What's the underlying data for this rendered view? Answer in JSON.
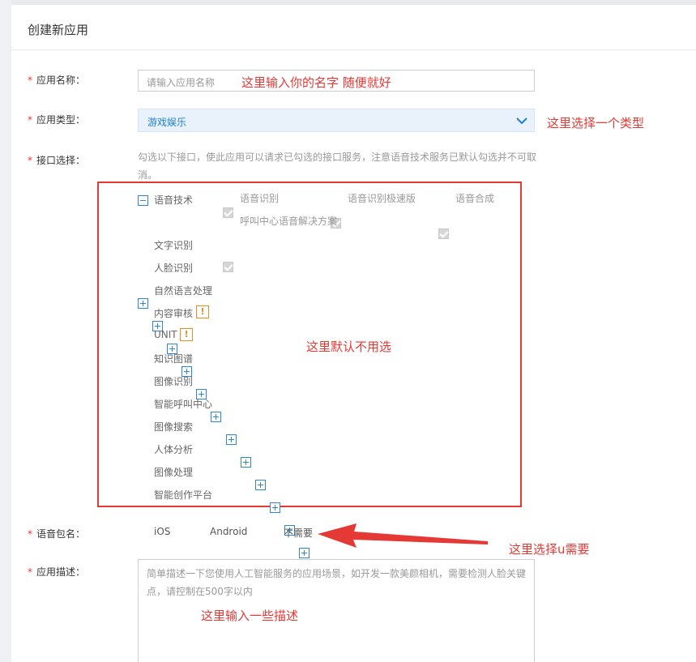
{
  "page": {
    "title": "创建新应用"
  },
  "form": {
    "app_name": {
      "label": "应用名称：",
      "placeholder": "请输入应用名称",
      "annotation": "这里输入你的名字  随便就好"
    },
    "app_type": {
      "label": "应用类型：",
      "value": "游戏娱乐",
      "annotation": "这里选择一个类型"
    },
    "api_select": {
      "label": "接口选择：",
      "hint": "勾选以下接口，使此应用可以请求已勾选的接口服务，注意语音技术服务已默认勾选并不可取消。",
      "annotation": "这里默认不用选",
      "speech": {
        "label": "语音技术",
        "options": [
          "语音识别",
          "语音识别极速版",
          "语音合成",
          "呼叫中心语音解决方案"
        ]
      },
      "categories": [
        {
          "label": "文字识别"
        },
        {
          "label": "人脸识别"
        },
        {
          "label": "自然语言处理"
        },
        {
          "label": "内容审核",
          "warn": "!"
        },
        {
          "label": "UNIT",
          "warn": "!"
        },
        {
          "label": "知识图谱"
        },
        {
          "label": "图像识别"
        },
        {
          "label": "智能呼叫中心"
        },
        {
          "label": "图像搜索"
        },
        {
          "label": "人体分析"
        },
        {
          "label": "图像处理"
        },
        {
          "label": "智能创作平台"
        }
      ]
    },
    "package_name": {
      "label": "语音包名：",
      "options": [
        "iOS",
        "Android",
        "不需要"
      ],
      "selected": "不需要",
      "annotation": "这里选择u需要"
    },
    "description": {
      "label": "应用描述：",
      "placeholder": "简单描述一下您使用人工智能服务的应用场景，如开发一款美颜相机，需要检测人脸关键点，请控制在500字以内",
      "annotation": "这里输入一些描述"
    }
  },
  "colors": {
    "accent": "#1f7fd4",
    "annotation": "#e53935",
    "required": "#e33333",
    "warning": "#f08c1c"
  }
}
